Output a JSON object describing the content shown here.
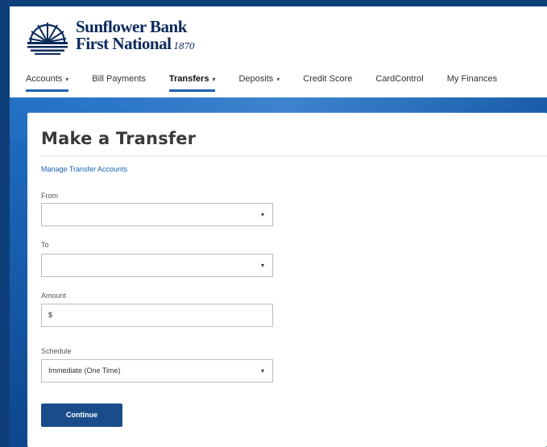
{
  "brand": {
    "line1": "Sunflower Bank",
    "line2": "First National",
    "est": "1870",
    "logo_icon": "sunflower-sunburst-icon",
    "colors": {
      "navy": "#0b2a5c",
      "accent": "#1b62b3",
      "button": "#1a4c8b"
    }
  },
  "nav": {
    "items": [
      {
        "label": "Accounts",
        "has_caret": true
      },
      {
        "label": "Bill Payments",
        "has_caret": false
      },
      {
        "label": "Transfers",
        "has_caret": true
      },
      {
        "label": "Deposits",
        "has_caret": true
      },
      {
        "label": "Credit Score",
        "has_caret": false
      },
      {
        "label": "CardControl",
        "has_caret": false
      },
      {
        "label": "My Finances",
        "has_caret": false
      }
    ],
    "caret_glyph": "▾"
  },
  "form": {
    "title": "Make a Transfer",
    "manage_link": "Manage Transfer Accounts",
    "from_label": "From",
    "from_value": "",
    "to_label": "To",
    "to_value": "",
    "amount_label": "Amount",
    "amount_value": "$",
    "schedule_label": "Schedule",
    "schedule_value": "Immediate (One Time)",
    "dropdown_glyph": "▾",
    "continue_label": "Continue"
  }
}
